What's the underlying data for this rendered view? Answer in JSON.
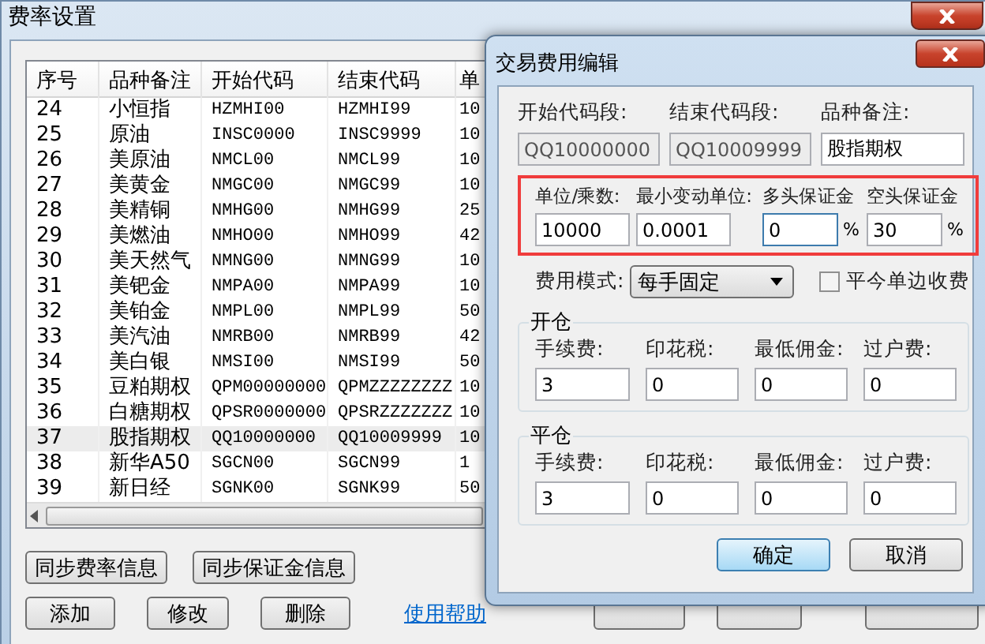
{
  "main_window": {
    "title": "费率设置",
    "table": {
      "columns": [
        "序号",
        "品种备注",
        "开始代码",
        "结束代码",
        "单"
      ],
      "rows": [
        {
          "cells": [
            "24",
            "小恒指",
            "HZMHI00",
            "HZMHI99",
            "10"
          ],
          "selected": false
        },
        {
          "cells": [
            "25",
            "原油",
            "INSC0000",
            "INSC9999",
            "10"
          ],
          "selected": false
        },
        {
          "cells": [
            "26",
            "美原油",
            "NMCL00",
            "NMCL99",
            "10"
          ],
          "selected": false
        },
        {
          "cells": [
            "27",
            "美黄金",
            "NMGC00",
            "NMGC99",
            "10"
          ],
          "selected": false
        },
        {
          "cells": [
            "28",
            "美精铜",
            "NMHG00",
            "NMHG99",
            "25"
          ],
          "selected": false
        },
        {
          "cells": [
            "29",
            "美燃油",
            "NMHO00",
            "NMHO99",
            "42"
          ],
          "selected": false
        },
        {
          "cells": [
            "30",
            "美天然气",
            "NMNG00",
            "NMNG99",
            "10"
          ],
          "selected": false
        },
        {
          "cells": [
            "31",
            "美钯金",
            "NMPA00",
            "NMPA99",
            "10"
          ],
          "selected": false
        },
        {
          "cells": [
            "32",
            "美铂金",
            "NMPL00",
            "NMPL99",
            "50"
          ],
          "selected": false
        },
        {
          "cells": [
            "33",
            "美汽油",
            "NMRB00",
            "NMRB99",
            "42"
          ],
          "selected": false
        },
        {
          "cells": [
            "34",
            "美白银",
            "NMSI00",
            "NMSI99",
            "50"
          ],
          "selected": false
        },
        {
          "cells": [
            "35",
            "豆粕期权",
            "QPM00000000",
            "QPMZZZZZZZZ",
            "10"
          ],
          "selected": false
        },
        {
          "cells": [
            "36",
            "白糖期权",
            "QPSR0000000",
            "QPSRZZZZZZZ",
            "10"
          ],
          "selected": false
        },
        {
          "cells": [
            "37",
            "股指期权",
            "QQ10000000",
            "QQ10009999",
            "10"
          ],
          "selected": true
        },
        {
          "cells": [
            "38",
            "新华A50",
            "SGCN00",
            "SGCN99",
            "1"
          ],
          "selected": false
        },
        {
          "cells": [
            "39",
            "新日经",
            "SGNK00",
            "SGNK99",
            "50"
          ],
          "selected": false
        }
      ]
    },
    "sync_buttons": [
      "同步费率信息",
      "同步保证金信息"
    ],
    "action_buttons": [
      "添加",
      "修改",
      "删除"
    ],
    "help_link": "使用帮助"
  },
  "dialog": {
    "title": "交易费用编辑",
    "code_fields": [
      {
        "label": "开始代码段:",
        "value": "QQ10000000",
        "disabled": true
      },
      {
        "label": "结束代码段:",
        "value": "QQ10009999",
        "disabled": true
      },
      {
        "label": "品种备注:",
        "value": "股指期权",
        "disabled": false
      }
    ],
    "contract_group": {
      "highlighted": true,
      "fields": [
        {
          "label": "单位/乘数:",
          "value": "10000",
          "focused": false
        },
        {
          "label": "最小变动单位:",
          "value": "0.0001",
          "focused": false
        },
        {
          "label": "多头保证金",
          "value": "0",
          "unit": "%",
          "focused": true
        },
        {
          "label": "空头保证金",
          "value": "30",
          "unit": "%",
          "focused": false
        }
      ]
    },
    "fee_mode": {
      "label": "费用模式:",
      "value": "每手固定"
    },
    "close_today_single": {
      "label": "平今单边收费",
      "checked": false
    },
    "fee_groups": [
      {
        "title": "开仓",
        "fields": [
          {
            "label": "手续费:",
            "value": "3"
          },
          {
            "label": "印花税:",
            "value": "0"
          },
          {
            "label": "最低佣金:",
            "value": "0"
          },
          {
            "label": "过户费:",
            "value": "0"
          }
        ]
      },
      {
        "title": "平仓",
        "fields": [
          {
            "label": "手续费:",
            "value": "3"
          },
          {
            "label": "印花税:",
            "value": "0"
          },
          {
            "label": "最低佣金:",
            "value": "0"
          },
          {
            "label": "过户费:",
            "value": "0"
          }
        ]
      }
    ],
    "buttons": [
      {
        "label": "确定",
        "default": true
      },
      {
        "label": "取消",
        "default": false
      }
    ]
  }
}
